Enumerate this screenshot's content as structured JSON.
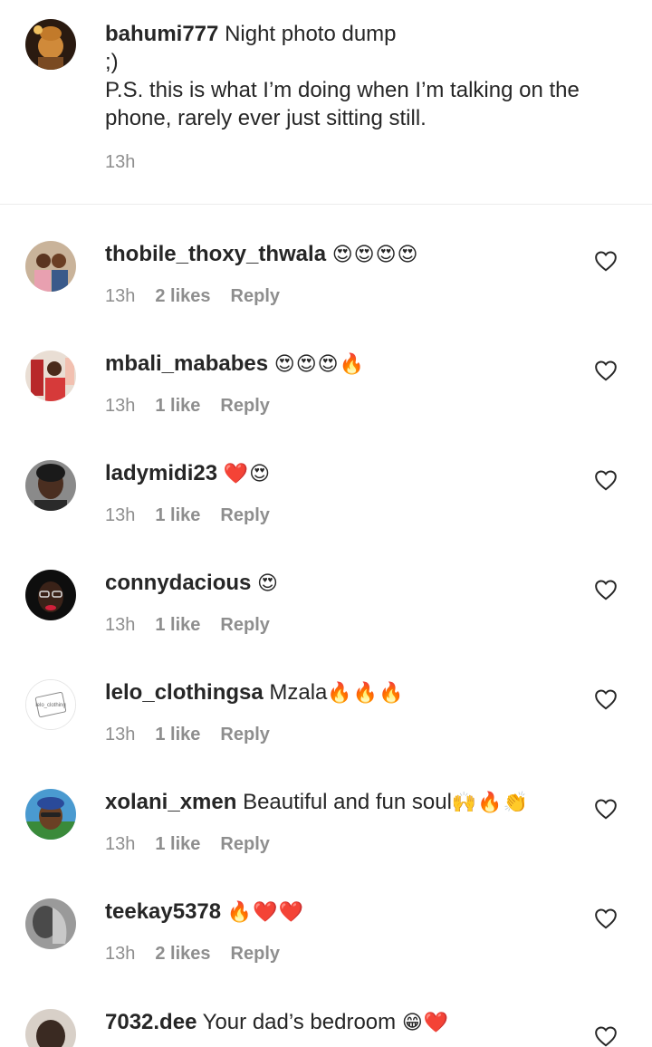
{
  "caption": {
    "username": "bahumi777",
    "text_line1": "Night photo dump",
    "text_line2": ";)",
    "text_line3": "P.S. this is what I’m doing when I’m talking on the",
    "text_line4": "phone, rarely ever just sitting still.",
    "time": "13h"
  },
  "comments": [
    {
      "username": "thobile_thoxy_thwala",
      "text": "",
      "emoji": "😍😍😍😍",
      "time": "13h",
      "likes": "2 likes",
      "reply": "Reply"
    },
    {
      "username": "mbali_mababes",
      "text": "",
      "emoji": "😍😍😍🔥",
      "time": "13h",
      "likes": "1 like",
      "reply": "Reply"
    },
    {
      "username": "ladymidi23",
      "text": "",
      "emoji": "❤️😍",
      "time": "13h",
      "likes": "1 like",
      "reply": "Reply"
    },
    {
      "username": "connydacious",
      "text": "",
      "emoji": "😍",
      "time": "13h",
      "likes": "1 like",
      "reply": "Reply"
    },
    {
      "username": "lelo_clothingsa",
      "text": "Mzala",
      "emoji": "🔥🔥🔥",
      "time": "13h",
      "likes": "1 like",
      "reply": "Reply",
      "avatar_text": "lelo_clothing"
    },
    {
      "username": "xolani_xmen",
      "text": "Beautiful and fun soul",
      "emoji": "🙌🔥👏",
      "time": "13h",
      "likes": "1 like",
      "reply": "Reply"
    },
    {
      "username": "teekay5378",
      "text": "",
      "emoji": "🔥❤️❤️",
      "time": "13h",
      "likes": "2 likes",
      "reply": "Reply"
    },
    {
      "username": "7032.dee",
      "text": "Your dad’s bedroom",
      "emoji": "😁❤️",
      "time": "",
      "likes": "",
      "reply": ""
    }
  ],
  "colors": {
    "text": "#262626",
    "secondary": "#8e8e8e",
    "divider": "#ececec"
  },
  "icons": {
    "like": "heart-outline-icon"
  }
}
